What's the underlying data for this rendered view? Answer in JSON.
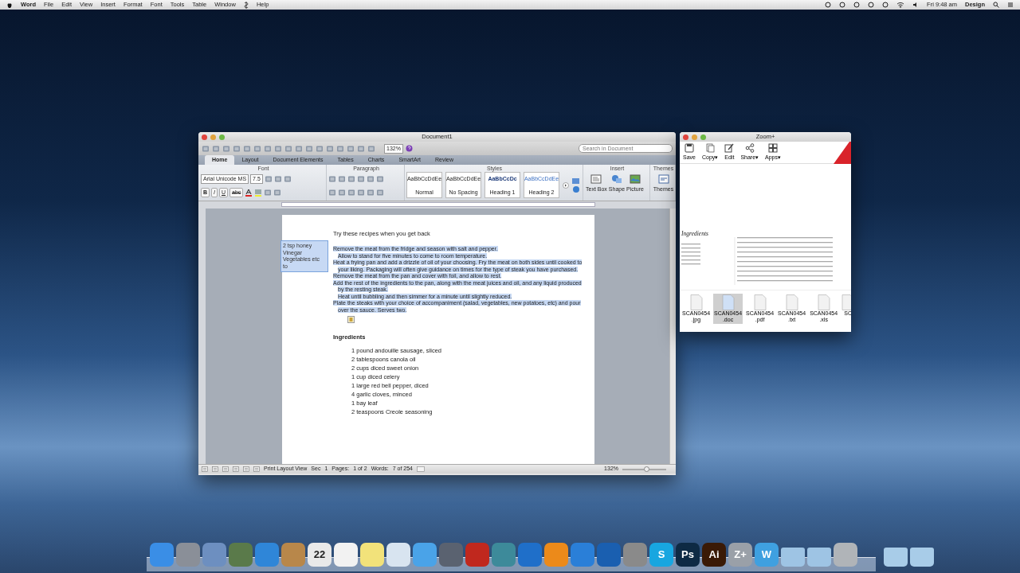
{
  "menu_bar": {
    "app": "Word",
    "items": [
      "File",
      "Edit",
      "View",
      "Insert",
      "Format",
      "Font",
      "Tools",
      "Table",
      "Window",
      "Help"
    ],
    "clock": "Fri 9:48 am",
    "user": "Design"
  },
  "word_window": {
    "title": "Document1",
    "zoom": "132%",
    "search": {
      "placeholder": "Search in Document"
    },
    "tabs": [
      {
        "label": "Home",
        "selected": true
      },
      {
        "label": "Layout",
        "selected": false
      },
      {
        "label": "Document Elements",
        "selected": false
      },
      {
        "label": "Tables",
        "selected": false
      },
      {
        "label": "Charts",
        "selected": false
      },
      {
        "label": "SmartArt",
        "selected": false
      },
      {
        "label": "Review",
        "selected": false
      }
    ],
    "groups": [
      "Font",
      "Paragraph",
      "Styles",
      "Insert",
      "Themes"
    ],
    "font_name": "Arial Unicode MS",
    "font_size": "7.5",
    "format_buttons": [
      "B",
      "I",
      "U",
      "abc"
    ],
    "styles": [
      {
        "sample": "AaBbCcDdEe",
        "name": "Normal",
        "kind": "normal"
      },
      {
        "sample": "AaBbCcDdEe",
        "name": "No Spacing",
        "kind": "normal"
      },
      {
        "sample": "AaBbCcDc",
        "name": "Heading 1",
        "kind": "heading1"
      },
      {
        "sample": "AaBbCcDdEe",
        "name": "Heading 2",
        "kind": "heading2"
      }
    ],
    "insert_buttons": [
      "Text Box",
      "Shape",
      "Picture"
    ],
    "themes_button": "Themes",
    "document": {
      "heading": "Try these recipes when you get back",
      "text_box": [
        "2 tsp honey",
        "Vinegar",
        "Vegetables etc",
        "to"
      ],
      "steps": [
        {
          "text": "Remove the meat from the fridge and season with salt and pepper.",
          "indent": false
        },
        {
          "text": "Allow to stand for five minutes to come to room temperature.",
          "indent": true
        },
        {
          "text": "Heat a frying pan and add a drizzle of oil of your choosing. Fry the meat on both sides until cooked to your liking. Packaging will often give guidance on times for the type of steak you have purchased.",
          "indent": false
        },
        {
          "text": "Remove the meat from the pan and cover with foil, and allow to rest.",
          "indent": false
        },
        {
          "text": "Add the rest of the ingredients to the pan, along with the meat juices and oil, and any liquid produced by the resting steak.",
          "indent": false
        },
        {
          "text": "Heat until bubbling and then simmer for a minute until slightly reduced.",
          "indent": true
        },
        {
          "text": "Plate the steaks with your choice of accompaniment (salad, vegetables, new potatoes, etc) and pour over the sauce. Serves two.",
          "indent": false
        }
      ],
      "ingredients_title": "Ingredients",
      "ingredients": [
        "1 pound andouille sausage, sliced",
        "2 tablespoons canola oil",
        "2 cups diced sweet onion",
        "1 cup diced celery",
        "1 large red bell pepper, diced",
        "4 garlic cloves, minced",
        "1 bay leaf",
        "2 teaspoons Creole seasoning"
      ]
    },
    "status_bar": {
      "view": "Print Layout View",
      "sec_label": "Sec",
      "sec": "1",
      "pages_label": "Pages:",
      "pages": "1 of 2",
      "words_label": "Words:",
      "words": "7 of 254",
      "zoom": "132%",
      "level": 0.55
    }
  },
  "zoom_window": {
    "title": "Zoom+",
    "tools": [
      "Save",
      "Copy▾",
      "Edit",
      "Share▾",
      "Apps▾"
    ],
    "preview_heading": "Ingredients",
    "files": [
      {
        "name": "SCAN0454",
        "ext": ".jpg",
        "selected": false
      },
      {
        "name": "SCAN0454",
        "ext": ".doc",
        "selected": true
      },
      {
        "name": "SCAN0454",
        "ext": ".pdf",
        "selected": false
      },
      {
        "name": "SCAN0454",
        "ext": ".txt",
        "selected": false
      },
      {
        "name": "SCAN0454",
        "ext": ".xls",
        "selected": false
      },
      {
        "name": "SC",
        "selected": false
      }
    ]
  },
  "dock": [
    {
      "kind": "app",
      "color": "#3a8ee6"
    },
    {
      "kind": "app",
      "color": "#8a8f98"
    },
    {
      "kind": "app",
      "color": "#6d8fc0"
    },
    {
      "kind": "app",
      "color": "#5a7a4a"
    },
    {
      "kind": "app",
      "color": "#2f86d8"
    },
    {
      "kind": "app",
      "color": "#b8874a"
    },
    {
      "kind": "app",
      "color": "#e9e9e9",
      "label": "22"
    },
    {
      "kind": "app",
      "color": "#f2f2f2"
    },
    {
      "kind": "app",
      "color": "#f2e27a"
    },
    {
      "kind": "app",
      "color": "#d8e4f0"
    },
    {
      "kind": "app",
      "color": "#4aa3e8"
    },
    {
      "kind": "app",
      "color": "#5a6270"
    },
    {
      "kind": "app",
      "color": "#c0281e"
    },
    {
      "kind": "app",
      "color": "#3d8a9a"
    },
    {
      "kind": "app",
      "color": "#1f6fc9"
    },
    {
      "kind": "app",
      "color": "#ec8a1a"
    },
    {
      "kind": "app",
      "color": "#2a7fd8"
    },
    {
      "kind": "app",
      "color": "#1a5fb0"
    },
    {
      "kind": "app",
      "color": "#8a8a8a"
    },
    {
      "kind": "app",
      "color": "#18a6e0",
      "label": "S"
    },
    {
      "kind": "app",
      "color": "#0e2a44",
      "label": "Ps"
    },
    {
      "kind": "app",
      "color": "#3a1a06",
      "label": "Ai"
    },
    {
      "kind": "app",
      "color": "#9aa0a8",
      "label": "Z+"
    },
    {
      "kind": "app",
      "color": "#3fa0e0",
      "label": "W"
    },
    {
      "kind": "folder",
      "color": "#9ec4e4"
    },
    {
      "kind": "folder",
      "color": "#9ec4e4"
    },
    {
      "kind": "app",
      "color": "#b0b4b8"
    },
    {
      "kind": "folder",
      "color": "#a8cce8"
    },
    {
      "kind": "folder",
      "color": "#a8cce8"
    }
  ]
}
